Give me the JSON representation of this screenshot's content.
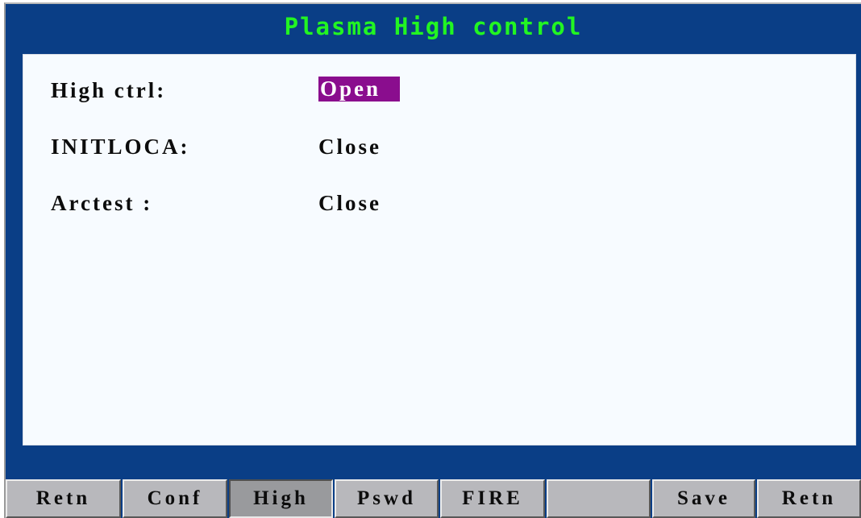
{
  "title": "Plasma High control",
  "params": [
    {
      "label": "High ctrl:",
      "value": "Open",
      "selected": true
    },
    {
      "label": "INITLOCA:",
      "value": "Close",
      "selected": false
    },
    {
      "label": "Arctest :",
      "value": "Close",
      "selected": false
    }
  ],
  "softkeys": [
    {
      "label": "Retn",
      "active": false
    },
    {
      "label": "Conf",
      "active": false
    },
    {
      "label": "High",
      "active": true
    },
    {
      "label": "Pswd",
      "active": false
    },
    {
      "label": "FIRE",
      "active": false
    },
    {
      "label": "",
      "active": false
    },
    {
      "label": "Save",
      "active": false
    },
    {
      "label": "Retn",
      "active": false
    }
  ],
  "colors": {
    "frame": "#0a3e86",
    "title": "#22f522",
    "panel": "#f7fbff",
    "selection": "#8a0d8e",
    "softkey": "#b8b8bc"
  }
}
